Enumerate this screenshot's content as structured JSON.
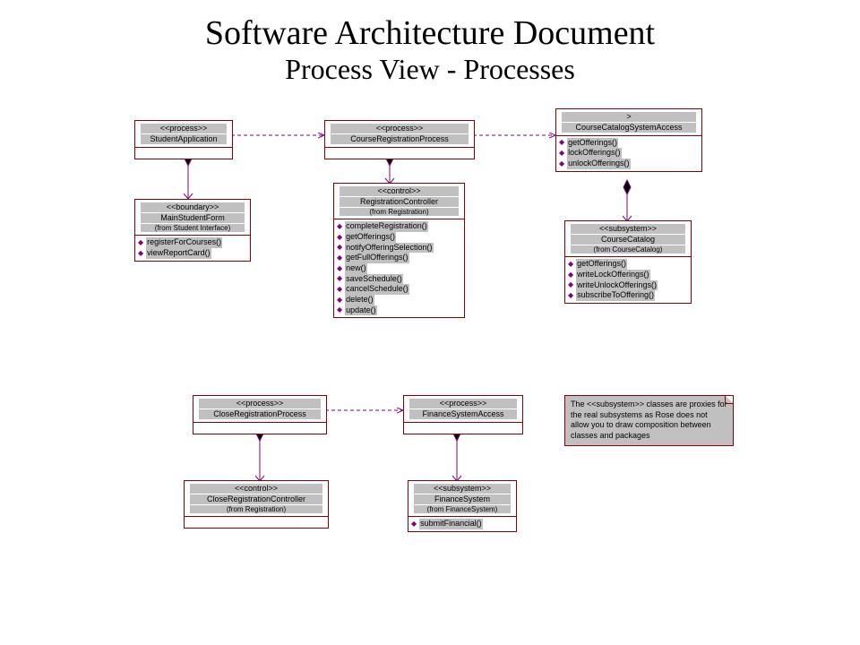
{
  "title": {
    "main": "Software Architecture Document",
    "sub": "Process View - Processes"
  },
  "boxes": {
    "studentApp": {
      "stereotype": "<<process>>",
      "name": "StudentApplication"
    },
    "courseRegProc": {
      "stereotype": "<<process>>",
      "name": "CourseRegistrationProcess"
    },
    "courseCatalogAccess": {
      "stereotype": ">",
      "name": "CourseCatalogSystemAccess",
      "ops": [
        "getOfferings()",
        "lockOfferings()",
        "unlockOfferings()"
      ]
    },
    "mainStudentForm": {
      "stereotype": "<<boundary>>",
      "name": "MainStudentForm",
      "from": "(from Student Interface)",
      "ops": [
        "registerForCourses()",
        "viewReportCard()"
      ]
    },
    "regController": {
      "stereotype": "<<control>>",
      "name": "RegistrationController",
      "from": "(from Registration)",
      "ops": [
        "completeRegistration()",
        "getOfferings()",
        "notifyOfferingSelection()",
        "getFullOfferings()",
        "new()",
        "saveSchedule()",
        "cancelSchedule()",
        "delete()",
        "update()"
      ]
    },
    "courseCatalog": {
      "stereotype": "<<subsystem>>",
      "name": "CourseCatalog",
      "from": "(from CourseCatalog)",
      "ops": [
        "getOfferings()",
        "writeLockOfferings()",
        "writeUnlockOfferings()",
        "subscribeToOffering()"
      ]
    },
    "closeRegProc": {
      "stereotype": "<<process>>",
      "name": "CloseRegistrationProcess"
    },
    "financeSysAccess": {
      "stereotype": "<<process>>",
      "name": "FinanceSystemAccess"
    },
    "closeRegCtrl": {
      "stereotype": "<<control>>",
      "name": "CloseRegistrationController",
      "from": "(from Registration)"
    },
    "financeSys": {
      "stereotype": "<<subsystem>>",
      "name": "FinanceSystem",
      "from": "(from FinanceSystem)",
      "ops": [
        "submitFinancial()"
      ]
    }
  },
  "note": {
    "text": "The <<subsystem>> classes are proxies for the real subsystems as Rose does not allow you to draw composition between classes and packages"
  }
}
